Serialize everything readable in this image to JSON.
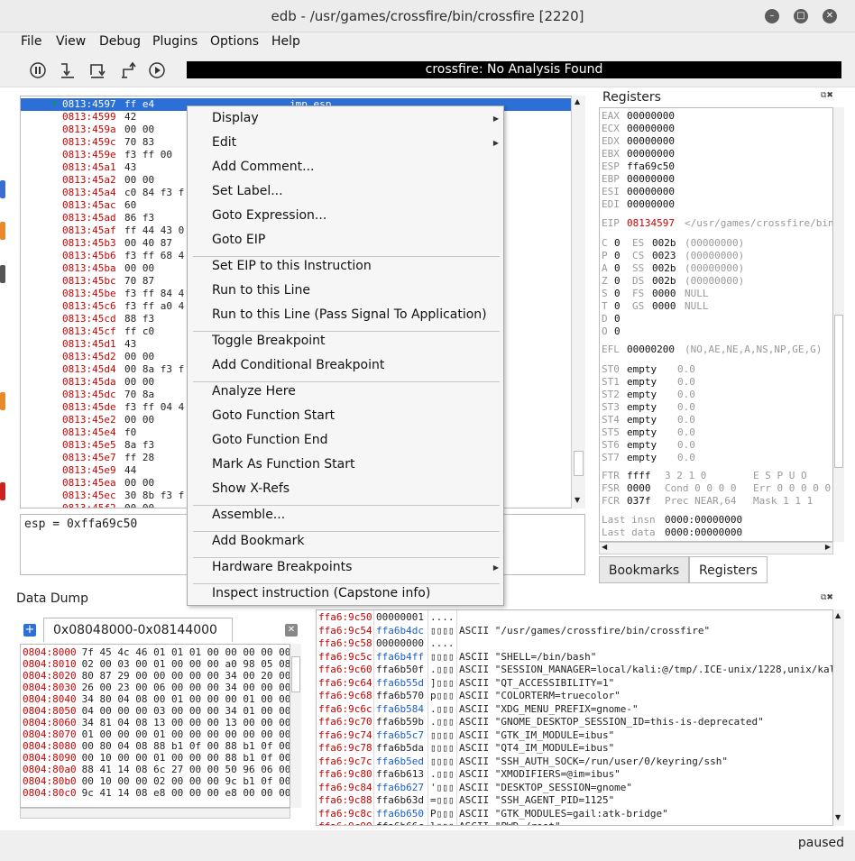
{
  "window": {
    "title": "edb - /usr/games/crossfire/bin/crossfire [2220]"
  },
  "menu": [
    "File",
    "View",
    "Debug",
    "Plugins",
    "Options",
    "Help"
  ],
  "toolbar": {
    "analysis": "crossfire: No Analysis Found"
  },
  "disasm": {
    "rows": [
      {
        "addr": "0813:4597",
        "bytes": "ff e4",
        "ins": "jmp esp"
      },
      {
        "addr": "0813:4599",
        "bytes": "42"
      },
      {
        "addr": "0813:459a",
        "bytes": "00 00"
      },
      {
        "addr": "0813:459c",
        "bytes": "70 83"
      },
      {
        "addr": "0813:459e",
        "bytes": "f3 ff 00"
      },
      {
        "addr": "0813:45a1",
        "bytes": "43"
      },
      {
        "addr": "0813:45a2",
        "bytes": "00 00"
      },
      {
        "addr": "0813:45a4",
        "bytes": "c0 84 f3 f"
      },
      {
        "addr": "0813:45ac",
        "bytes": "60"
      },
      {
        "addr": "0813:45ad",
        "bytes": "86 f3"
      },
      {
        "addr": "0813:45af",
        "bytes": "ff 44 43 0"
      },
      {
        "addr": "0813:45b3",
        "bytes": "00 40 87"
      },
      {
        "addr": "0813:45b6",
        "bytes": "f3 ff 68 4"
      },
      {
        "addr": "0813:45ba",
        "bytes": "00 00"
      },
      {
        "addr": "0813:45bc",
        "bytes": "70 87"
      },
      {
        "addr": "0813:45be",
        "bytes": "f3 ff 84 4"
      },
      {
        "addr": "0813:45c6",
        "bytes": "f3 ff a0 4"
      },
      {
        "addr": "0813:45cd",
        "bytes": "88 f3"
      },
      {
        "addr": "0813:45cf",
        "bytes": "ff c0"
      },
      {
        "addr": "0813:45d1",
        "bytes": "43"
      },
      {
        "addr": "0813:45d2",
        "bytes": "00 00"
      },
      {
        "addr": "0813:45d4",
        "bytes": "00 8a f3 f"
      },
      {
        "addr": "0813:45da",
        "bytes": "00 00"
      },
      {
        "addr": "0813:45dc",
        "bytes": "70 8a"
      },
      {
        "addr": "0813:45de",
        "bytes": "f3 ff 04 4"
      },
      {
        "addr": "0813:45e2",
        "bytes": "00 00"
      },
      {
        "addr": "0813:45e4",
        "bytes": "f0"
      },
      {
        "addr": "0813:45e5",
        "bytes": "8a f3"
      },
      {
        "addr": "0813:45e7",
        "bytes": "ff 28"
      },
      {
        "addr": "0813:45e9",
        "bytes": "44"
      },
      {
        "addr": "0813:45ea",
        "bytes": "00 00"
      },
      {
        "addr": "0813:45ec",
        "bytes": "30 8b f3 f"
      },
      {
        "addr": "0813:45f2",
        "bytes": "00 00"
      }
    ]
  },
  "expression": "esp = 0xffa69c50",
  "context_menu": {
    "items": [
      {
        "label": "Display",
        "sub": true
      },
      {
        "label": "Edit",
        "sub": true
      },
      {
        "label": "Add Comment..."
      },
      {
        "label": "Set Label..."
      },
      {
        "label": "Goto Expression..."
      },
      {
        "label": "Goto EIP",
        "sep_after": true
      },
      {
        "label": "Set EIP to this Instruction"
      },
      {
        "label": "Run to this Line"
      },
      {
        "label": "Run to this Line (Pass Signal To Application)",
        "sep_after": true
      },
      {
        "label": "Toggle Breakpoint"
      },
      {
        "label": "Add Conditional Breakpoint",
        "sep_after": true
      },
      {
        "label": "Analyze Here"
      },
      {
        "label": "Goto Function Start"
      },
      {
        "label": "Goto Function End"
      },
      {
        "label": "Mark As Function Start"
      },
      {
        "label": "Show X-Refs",
        "sep_after": true
      },
      {
        "label": "Assemble...",
        "sep_after": true
      },
      {
        "label": "Add Bookmark",
        "sep_after": true
      },
      {
        "label": "Hardware Breakpoints",
        "sub": true,
        "sep_after": true
      },
      {
        "label": "Inspect instruction (Capstone info)"
      }
    ]
  },
  "registers": {
    "title": "Registers",
    "gp": [
      {
        "n": "EAX",
        "v": "00000000"
      },
      {
        "n": "ECX",
        "v": "00000000"
      },
      {
        "n": "EDX",
        "v": "00000000"
      },
      {
        "n": "EBX",
        "v": "00000000"
      },
      {
        "n": "ESP",
        "v": "ffa69c50"
      },
      {
        "n": "EBP",
        "v": "00000000"
      },
      {
        "n": "ESI",
        "v": "00000000"
      },
      {
        "n": "EDI",
        "v": "00000000"
      }
    ],
    "eip": {
      "n": "EIP",
      "v": "08134597",
      "c": "</usr/games/crossfire/bin"
    },
    "flags": [
      {
        "f": "C",
        "fv": "0",
        "s": "ES",
        "sv": "002b",
        "sc": "(00000000)"
      },
      {
        "f": "P",
        "fv": "0",
        "s": "CS",
        "sv": "0023",
        "sc": "(00000000)"
      },
      {
        "f": "A",
        "fv": "0",
        "s": "SS",
        "sv": "002b",
        "sc": "(00000000)"
      },
      {
        "f": "Z",
        "fv": "0",
        "s": "DS",
        "sv": "002b",
        "sc": "(00000000)"
      },
      {
        "f": "S",
        "fv": "0",
        "s": "FS",
        "sv": "0000",
        "sc": "NULL"
      },
      {
        "f": "T",
        "fv": "0",
        "s": "GS",
        "sv": "0000",
        "sc": "NULL"
      },
      {
        "f": "D",
        "fv": "0"
      },
      {
        "f": "O",
        "fv": "0"
      }
    ],
    "efl": {
      "n": "EFL",
      "v": "00000200",
      "c": "(NO,AE,NE,A,NS,NP,GE,G)"
    },
    "st": [
      {
        "n": "ST0",
        "v": "empty",
        "c": "0.0"
      },
      {
        "n": "ST1",
        "v": "empty",
        "c": "0.0"
      },
      {
        "n": "ST2",
        "v": "empty",
        "c": "0.0"
      },
      {
        "n": "ST3",
        "v": "empty",
        "c": "0.0"
      },
      {
        "n": "ST4",
        "v": "empty",
        "c": "0.0"
      },
      {
        "n": "ST5",
        "v": "empty",
        "c": "0.0"
      },
      {
        "n": "ST6",
        "v": "empty",
        "c": "0.0"
      },
      {
        "n": "ST7",
        "v": "empty",
        "c": "0.0"
      }
    ],
    "fpu": [
      {
        "n": "FTR",
        "v": "ffff",
        "c": "3 2 1 0",
        "d": "E S P U O"
      },
      {
        "n": "FSR",
        "v": "0000",
        "c": "Cond 0 0 0 0",
        "d": "Err 0 0 0 0 0"
      },
      {
        "n": "FCR",
        "v": "037f",
        "c": "Prec NEAR,64",
        "d": "Mask  1 1 1"
      }
    ],
    "last": [
      {
        "n": "Last insn",
        "v": "0000:00000000"
      },
      {
        "n": "Last data",
        "v": "0000:00000000"
      }
    ]
  },
  "tabs": {
    "bookmarks": "Bookmarks",
    "registers": "Registers"
  },
  "data_dump": {
    "title": "Data Dump",
    "tab": "0x08048000-0x08144000",
    "rows": [
      {
        "a": "0804:8000",
        "b": "7f 45 4c 46 01 01 01 00 00 00 00 00"
      },
      {
        "a": "0804:8010",
        "b": "02 00 03 00 01 00 00 00 a0 98 05 08"
      },
      {
        "a": "0804:8020",
        "b": "80 87 29 00 00 00 00 00 34 00 20 00"
      },
      {
        "a": "0804:8030",
        "b": "26 00 23 00 06 00 00 00 34 00 00 00"
      },
      {
        "a": "0804:8040",
        "b": "34 80 04 08 00 01 00 00 00 01 00 00"
      },
      {
        "a": "0804:8050",
        "b": "04 00 00 00 03 00 00 00 34 01 00 00"
      },
      {
        "a": "0804:8060",
        "b": "34 81 04 08 13 00 00 00 13 00 00 00"
      },
      {
        "a": "0804:8070",
        "b": "01 00 00 00 01 00 00 00 00 00 00 00"
      },
      {
        "a": "0804:8080",
        "b": "00 80 04 08 88 b1 0f 00 88 b1 0f 00"
      },
      {
        "a": "0804:8090",
        "b": "00 10 00 00 01 00 00 00 88 b1 0f 00"
      },
      {
        "a": "0804:80a0",
        "b": "88 41 14 08 6c 27 00 00 50 96 06 00"
      },
      {
        "a": "0804:80b0",
        "b": "00 10 00 00 02 00 00 00 9c b1 0f 00"
      },
      {
        "a": "0804:80c0",
        "b": "9c 41 14 08 e8 00 00 00 e8 00 00 00"
      }
    ]
  },
  "stack": {
    "rows": [
      {
        "a": "ffa6:9c50",
        "v": "00000001",
        "c": "....",
        "t": ""
      },
      {
        "a": "ffa6:9c54",
        "v": "ffa6b4dc",
        "c": "▯▯▯▯",
        "t": "ASCII \"/usr/games/crossfire/bin/crossfire\""
      },
      {
        "a": "ffa6:9c58",
        "v": "00000000",
        "c": "....",
        "t": ""
      },
      {
        "a": "ffa6:9c5c",
        "v": "ffa6b4ff",
        "c": "▯▯▯▯",
        "t": "ASCII \"SHELL=/bin/bash\""
      },
      {
        "a": "ffa6:9c60",
        "v": "ffa6b50f",
        "c": ".▯▯▯",
        "t": "ASCII \"SESSION_MANAGER=local/kali:@/tmp/.ICE-unix/1228,unix/kal"
      },
      {
        "a": "ffa6:9c64",
        "v": "ffa6b55d",
        "c": "]▯▯▯",
        "t": "ASCII \"QT_ACCESSIBILITY=1\""
      },
      {
        "a": "ffa6:9c68",
        "v": "ffa6b570",
        "c": "p▯▯▯",
        "t": "ASCII \"COLORTERM=truecolor\""
      },
      {
        "a": "ffa6:9c6c",
        "v": "ffa6b584",
        "c": ".▯▯▯",
        "t": "ASCII \"XDG_MENU_PREFIX=gnome-\""
      },
      {
        "a": "ffa6:9c70",
        "v": "ffa6b59b",
        "c": ".▯▯▯",
        "t": "ASCII \"GNOME_DESKTOP_SESSION_ID=this-is-deprecated\""
      },
      {
        "a": "ffa6:9c74",
        "v": "ffa6b5c7",
        "c": "▯▯▯▯",
        "t": "ASCII \"GTK_IM_MODULE=ibus\""
      },
      {
        "a": "ffa6:9c78",
        "v": "ffa6b5da",
        "c": "▯▯▯▯",
        "t": "ASCII \"QT4_IM_MODULE=ibus\""
      },
      {
        "a": "ffa6:9c7c",
        "v": "ffa6b5ed",
        "c": "▯▯▯▯",
        "t": "ASCII \"SSH_AUTH_SOCK=/run/user/0/keyring/ssh\""
      },
      {
        "a": "ffa6:9c80",
        "v": "ffa6b613",
        "c": ".▯▯▯",
        "t": "ASCII \"XMODIFIERS=@im=ibus\""
      },
      {
        "a": "ffa6:9c84",
        "v": "ffa6b627",
        "c": "'▯▯▯",
        "t": "ASCII \"DESKTOP_SESSION=gnome\""
      },
      {
        "a": "ffa6:9c88",
        "v": "ffa6b63d",
        "c": "=▯▯▯",
        "t": "ASCII \"SSH_AGENT_PID=1125\""
      },
      {
        "a": "ffa6:9c8c",
        "v": "ffa6b650",
        "c": "P▯▯▯",
        "t": "ASCII \"GTK_MODULES=gail:atk-bridge\""
      },
      {
        "a": "ffa6:9c90",
        "v": "ffa6b66c",
        "c": "l▯▯▯",
        "t": "ASCII \"PWD=/root\""
      }
    ]
  },
  "status": "paused"
}
